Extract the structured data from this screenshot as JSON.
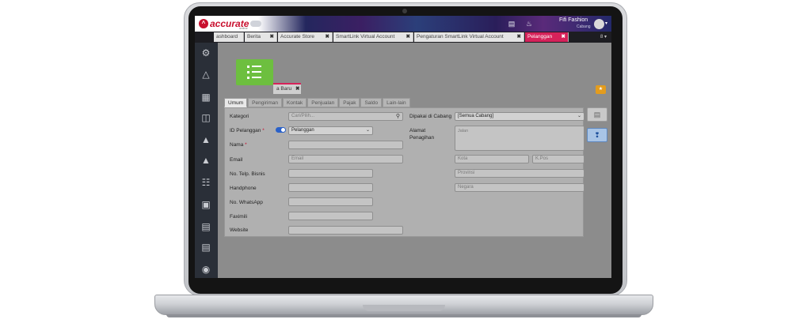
{
  "app": {
    "logo_text": "accurate",
    "brand_sub": "online",
    "user_name": "Fifi Fashion",
    "user_sub": "Cabang"
  },
  "tabs": [
    {
      "label": "ashboard",
      "closable": false
    },
    {
      "label": "Berita",
      "closable": true
    },
    {
      "label": "Accurate Store",
      "closable": true
    },
    {
      "label": "SmartLink Virtual Account",
      "closable": true
    },
    {
      "label": "Pengaturan SmartLink Virtual Account",
      "closable": true
    },
    {
      "label": "Pelanggan",
      "closable": true,
      "active": true
    }
  ],
  "tabs_more": "8",
  "subtab": {
    "label": "a Baru"
  },
  "form_tabs": [
    "Umum",
    "Pengiriman",
    "Kontak",
    "Penjualan",
    "Pajak",
    "Saldo",
    "Lain-lain"
  ],
  "form": {
    "kategori_label": "Kategori",
    "kategori_placeholder": "Cari/Pilih...",
    "id_label": "ID Pelanggan",
    "id_value": "Pelanggan",
    "nama_label": "Nama",
    "email_label": "Email",
    "email_placeholder": "Email",
    "telp_label": "No. Telp. Bisnis",
    "handphone_label": "Handphone",
    "whatsapp_label": "No. WhatsApp",
    "faximili_label": "Faximili",
    "website_label": "Website",
    "dipakai_label": "Dipakai di Cabang",
    "dipakai_value": "[Semua Cabang]",
    "alamat_label": "Alamat",
    "penagihan_label": "Penagihan",
    "jalan_placeholder": "Jalan",
    "kota_placeholder": "Kota",
    "kpos_placeholder": "K.Pos",
    "provinsi_placeholder": "Provinsi",
    "negara_placeholder": "Negara",
    "required_mark": "*"
  },
  "colors": {
    "accent": "#d6225a",
    "sidebar": "#2a2f38",
    "list_tile": "#6dbf3f",
    "toggle": "#2a61c9"
  }
}
